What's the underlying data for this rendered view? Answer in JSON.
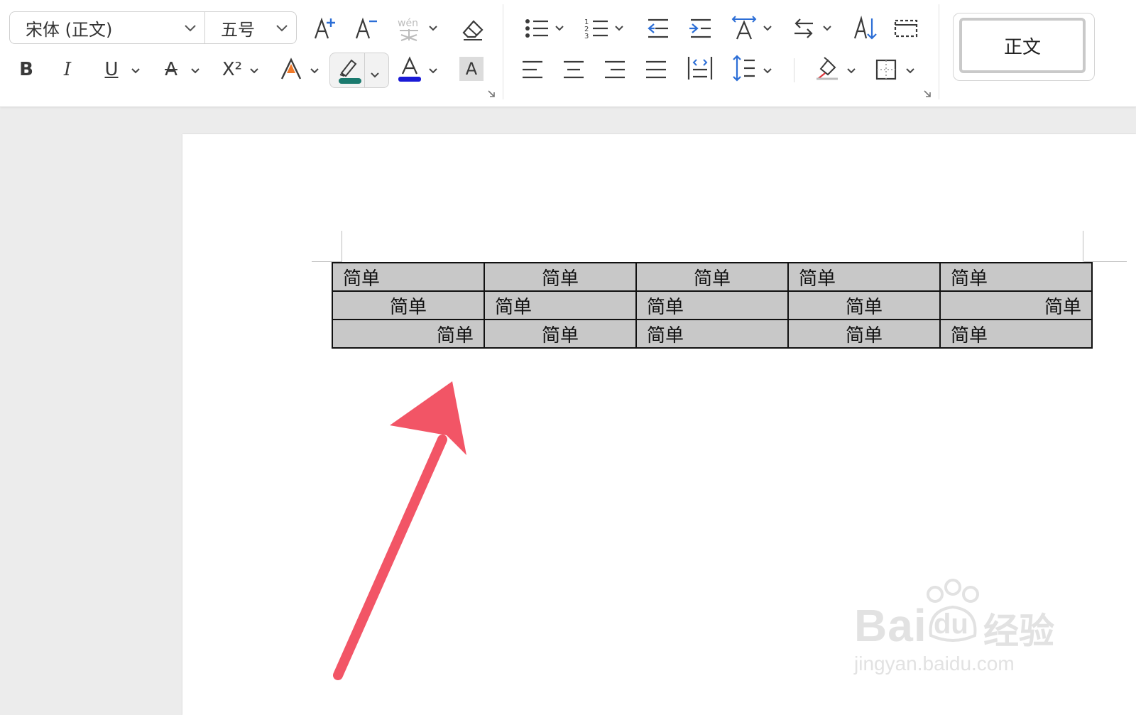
{
  "toolbar": {
    "font_name": "宋体 (正文)",
    "font_size": "五号",
    "style_label": "正文",
    "bold_glyph": "B",
    "italic_glyph": "I",
    "underline_glyph": "U",
    "strike_glyph": "A",
    "superscript_glyph": "X²",
    "font_color_glyph": "A",
    "char_shading_glyph": "A",
    "highlight_color": "#1a7a6e",
    "font_color": "#1a1ad6",
    "accent_blue": "#2c6ed6"
  },
  "document": {
    "table_rows": [
      [
        "简单",
        "简单",
        "简单",
        "简单",
        "简单"
      ],
      [
        "简单",
        "简单",
        "简单",
        "简单",
        "简单"
      ],
      [
        "简单",
        "简单",
        "简单",
        "简单",
        "简单"
      ]
    ],
    "cell_alignment": [
      [
        "left",
        "center",
        "center",
        "left",
        "left"
      ],
      [
        "center",
        "left",
        "left",
        "center",
        "right"
      ],
      [
        "right",
        "center",
        "left",
        "center",
        "left"
      ]
    ],
    "table_shading": "#c8c8c8"
  },
  "annotation": {
    "arrow_color": "#f25566",
    "arrow_direction": "points-up-right-to-table"
  },
  "watermark": {
    "brand": "Bai",
    "brand_suffix": "经验",
    "url": "jingyan.baidu.com",
    "paw_text": "du"
  }
}
